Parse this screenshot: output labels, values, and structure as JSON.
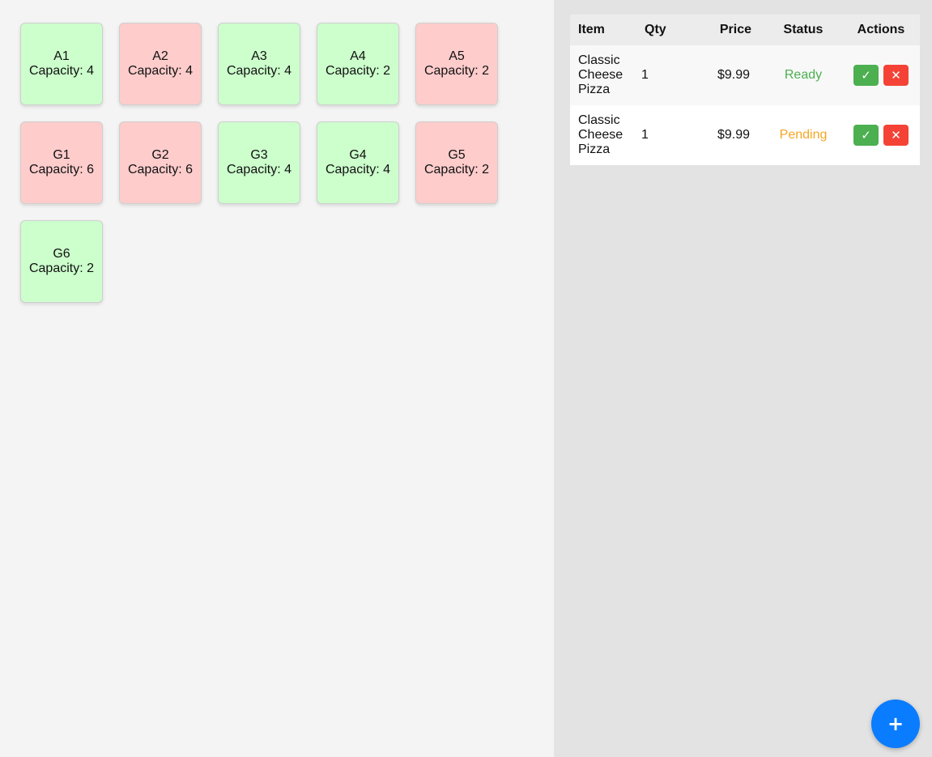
{
  "tables": [
    {
      "name": "A1",
      "capacity_text": "Capacity: 4",
      "status": "available",
      "color": "#ccffcc"
    },
    {
      "name": "A2",
      "capacity_text": "Capacity: 4",
      "status": "occupied",
      "color": "#ffcccc"
    },
    {
      "name": "A3",
      "capacity_text": "Capacity: 4",
      "status": "available",
      "color": "#ccffcc"
    },
    {
      "name": "A4",
      "capacity_text": "Capacity: 2",
      "status": "available",
      "color": "#ccffcc"
    },
    {
      "name": "A5",
      "capacity_text": "Capacity: 2",
      "status": "occupied",
      "color": "#ffcccc"
    },
    {
      "name": "G1",
      "capacity_text": "Capacity: 6",
      "status": "occupied",
      "color": "#ffcccc"
    },
    {
      "name": "G2",
      "capacity_text": "Capacity: 6",
      "status": "occupied",
      "color": "#ffcccc"
    },
    {
      "name": "G3",
      "capacity_text": "Capacity: 4",
      "status": "available",
      "color": "#ccffcc"
    },
    {
      "name": "G4",
      "capacity_text": "Capacity: 4",
      "status": "available",
      "color": "#ccffcc"
    },
    {
      "name": "G5",
      "capacity_text": "Capacity: 2",
      "status": "occupied",
      "color": "#ffcccc"
    },
    {
      "name": "G6",
      "capacity_text": "Capacity: 2",
      "status": "available",
      "color": "#ccffcc"
    }
  ],
  "orders": {
    "headers": {
      "item": "Item",
      "qty": "Qty",
      "price": "Price",
      "status": "Status",
      "actions": "Actions"
    },
    "rows": [
      {
        "item": "Classic Cheese Pizza",
        "qty": "1",
        "price": "$9.99",
        "status": "Ready",
        "status_color": "#4caf50",
        "accept_icon": "check-icon",
        "accept_glyph": "✓",
        "reject_icon": "x-icon",
        "reject_glyph": "✕"
      },
      {
        "item": "Classic Cheese Pizza",
        "qty": "1",
        "price": "$9.99",
        "status": "Pending",
        "status_color": "#f5a623",
        "accept_icon": "check-icon",
        "accept_glyph": "✓",
        "reject_icon": "x-icon",
        "reject_glyph": "✕"
      }
    ]
  },
  "fab": {
    "glyph": "+",
    "icon": "plus-icon",
    "color": "#0a7cff"
  }
}
